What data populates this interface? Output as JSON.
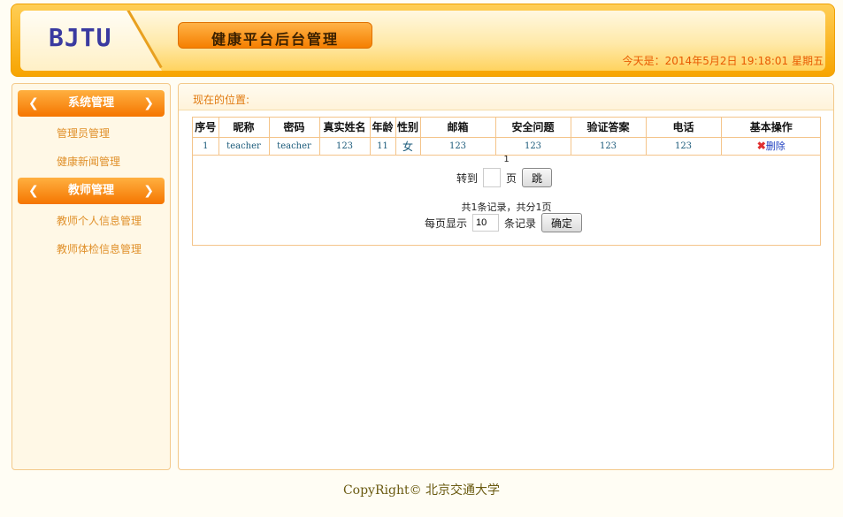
{
  "header": {
    "logo": "BJTU",
    "title": "健康平台后台管理",
    "date": "今天是：2014年5月2日 19:18:01 星期五"
  },
  "sidebar": {
    "groups": [
      {
        "label": "系统管理",
        "items": [
          "管理员管理",
          "健康新闻管理"
        ]
      },
      {
        "label": "教师管理",
        "items": [
          "教师个人信息管理",
          "教师体检信息管理"
        ]
      }
    ]
  },
  "main": {
    "location": "现在的位置:",
    "table": {
      "headers": [
        "序号",
        "昵称",
        "密码",
        "真实姓名",
        "年龄",
        "性别",
        "邮箱",
        "安全问题",
        "验证答案",
        "电话",
        "基本操作"
      ],
      "rows": [
        [
          "1",
          "teacher",
          "teacher",
          "123",
          "11",
          "女",
          "123",
          "123",
          "123",
          "123",
          "删除"
        ]
      ]
    },
    "pager": {
      "page_links": "1",
      "goto_label": "转到",
      "page_unit": "页",
      "jump_button": "跳",
      "summary": "共1条记录，共分1页",
      "per_page_label": "每页显示",
      "per_page_value": "10",
      "records_unit": "条记录",
      "confirm_button": "确定"
    }
  },
  "footer": {
    "copyright": "CopyRight© 北京交通大学"
  }
}
